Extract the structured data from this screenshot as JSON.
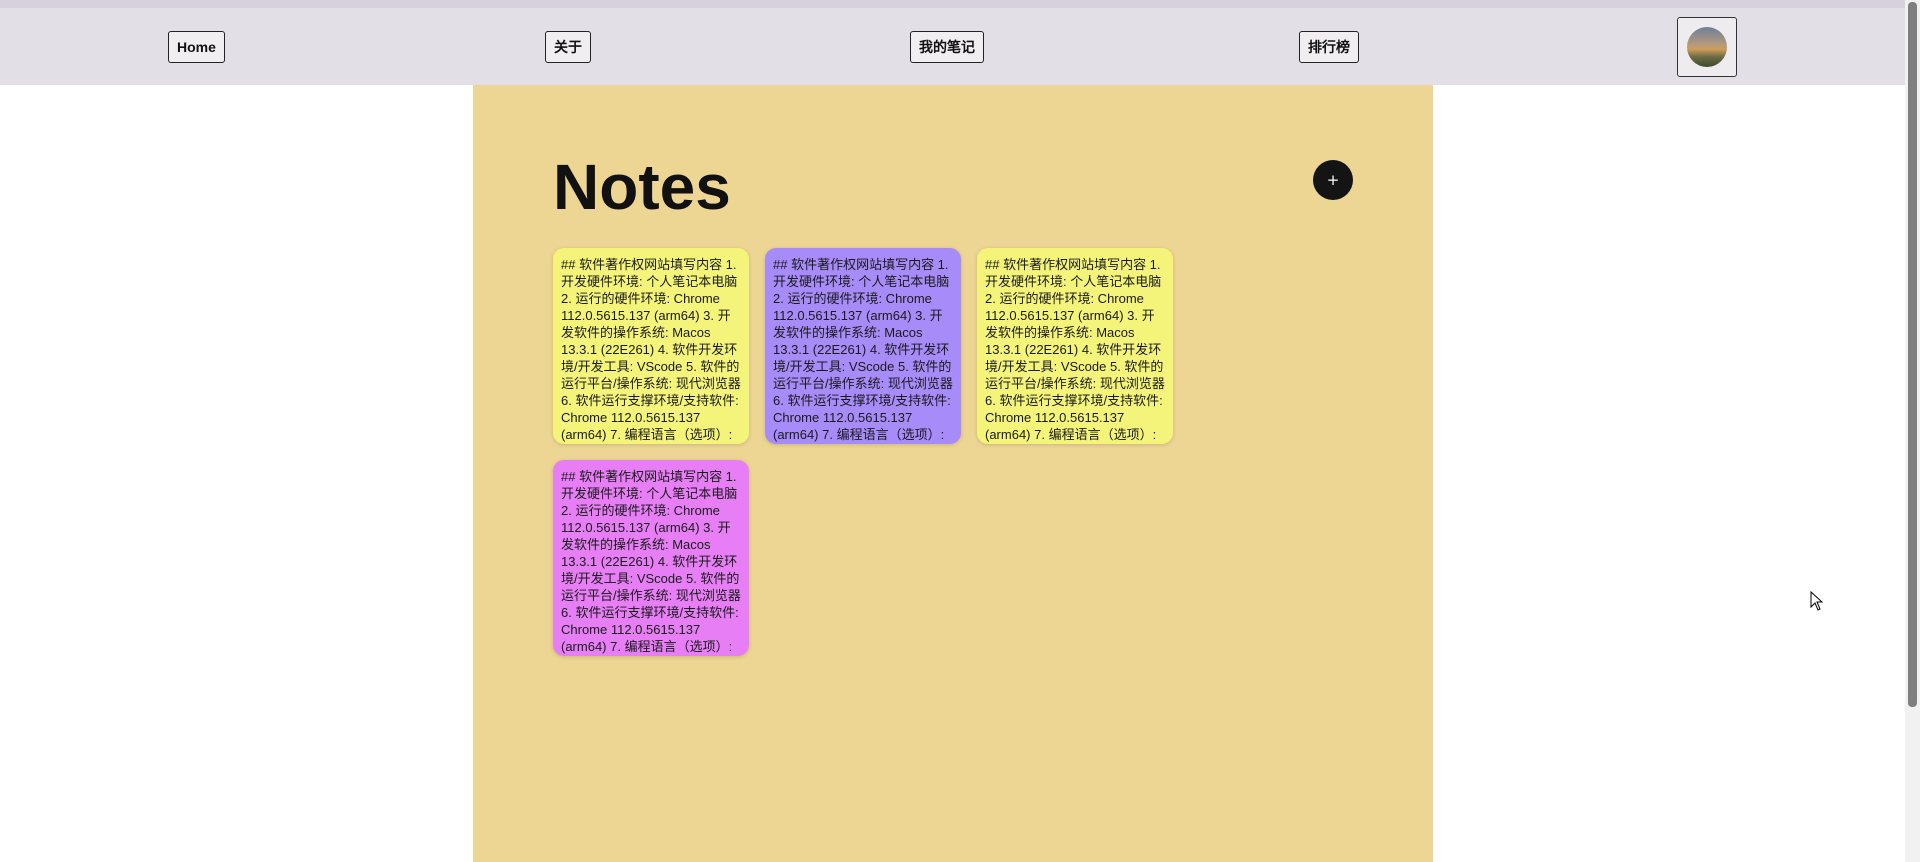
{
  "nav": {
    "home_label": "Home",
    "about_label": "关于",
    "notes_label": "我的笔记",
    "ranking_label": "排行榜"
  },
  "main": {
    "title": "Notes",
    "add_label": "+",
    "background_color": "#edd593"
  },
  "notes": [
    {
      "text": "## 软件著作权网站填写内容 1. 开发硬件环境: 个人笔记本电脑 2. 运行的硬件环境: Chrome 112.0.5615.137 (arm64) 3. 开发软件的操作系统: Macos 13.3.1 (22E261) 4. 软件开发环境/开发工具: VScode 5. 软件的运行平台/操作系统: 现代浏览器 6. 软件运行支撑环境/支持软件: Chrome 112.0.5615.137 (arm64) 7. 编程语言（选项）:",
      "color": "#f5f47a"
    },
    {
      "text": "## 软件著作权网站填写内容 1. 开发硬件环境: 个人笔记本电脑 2. 运行的硬件环境: Chrome 112.0.5615.137 (arm64) 3. 开发软件的操作系统: Macos 13.3.1 (22E261) 4. 软件开发环境/开发工具: VScode 5. 软件的运行平台/操作系统: 现代浏览器 6. 软件运行支撑环境/支持软件: Chrome 112.0.5615.137 (arm64) 7. 编程语言（选项）:",
      "color": "#a78bf9"
    },
    {
      "text": "## 软件著作权网站填写内容 1. 开发硬件环境: 个人笔记本电脑 2. 运行的硬件环境: Chrome 112.0.5615.137 (arm64) 3. 开发软件的操作系统: Macos 13.3.1 (22E261) 4. 软件开发环境/开发工具: VScode 5. 软件的运行平台/操作系统: 现代浏览器 6. 软件运行支撑环境/支持软件: Chrome 112.0.5615.137 (arm64) 7. 编程语言（选项）:",
      "color": "#f5f47a"
    },
    {
      "text": "## 软件著作权网站填写内容 1. 开发硬件环境: 个人笔记本电脑 2. 运行的硬件环境: Chrome 112.0.5615.137 (arm64) 3. 开发软件的操作系统: Macos 13.3.1 (22E261) 4. 软件开发环境/开发工具: VScode 5. 软件的运行平台/操作系统: 现代浏览器 6. 软件运行支撑环境/支持软件: Chrome 112.0.5615.137 (arm64) 7. 编程语言（选项）:",
      "color": "#e77ef5"
    }
  ]
}
